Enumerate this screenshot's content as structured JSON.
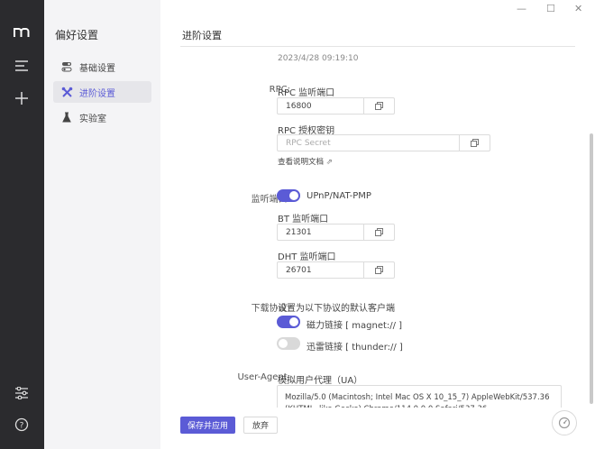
{
  "sidebar": {
    "title": "偏好设置",
    "items": [
      {
        "label": "基础设置"
      },
      {
        "label": "进阶设置"
      },
      {
        "label": "实验室"
      }
    ]
  },
  "window": {
    "minimize": "—",
    "maximize": "☐",
    "close": "✕"
  },
  "page": {
    "title": "进阶设置"
  },
  "timestamp": "2023/4/28 09:19:10",
  "rpc": {
    "label": "RPC:",
    "port_label": "RPC 监听端口",
    "port_value": "16800",
    "secret_label": "RPC 授权密钥",
    "secret_placeholder": "RPC Secret",
    "doc_link": "查看说明文档"
  },
  "listen": {
    "label": "监听端口:",
    "upnp_label": "UPnP/NAT-PMP",
    "upnp_on": true,
    "bt_label": "BT 监听端口",
    "bt_value": "21301",
    "dht_label": "DHT 监听端口",
    "dht_value": "26701"
  },
  "protocol": {
    "label": "下载协议:",
    "desc": "设置为以下协议的默认客户端",
    "magnet_label": "磁力链接 [ magnet:// ]",
    "magnet_on": true,
    "thunder_label": "迅雷链接 [ thunder:// ]",
    "thunder_on": false
  },
  "ua": {
    "label": "User-Agent:",
    "desc": "模拟用户代理（UA）",
    "value": "Mozilla/5.0 (Macintosh; Intel Mac OS X 10_15_7) AppleWebKit/537.36 (KHTML, like Gecko) Chrome/114.0.0.0 Safari/537.36"
  },
  "footer": {
    "save_label": "保存并应用",
    "discard_label": "放弃"
  },
  "colors": {
    "accent": "#5b5bd6",
    "rail": "#2b2b2e",
    "sidebar": "#f4f4f6"
  }
}
